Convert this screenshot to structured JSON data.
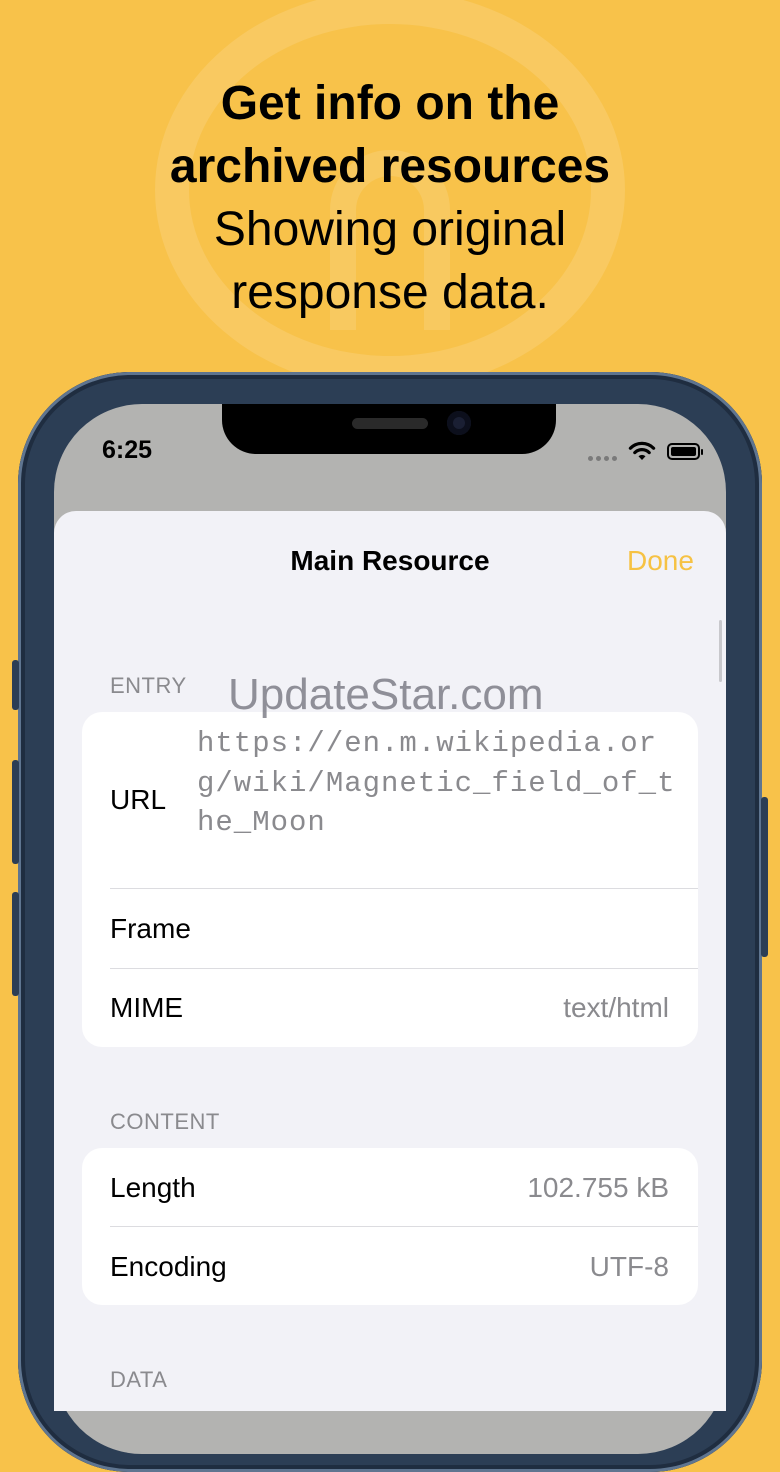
{
  "headline": {
    "bold_line1": "Get info on the",
    "bold_line2": "archived resources",
    "regular_line1": "Showing original",
    "regular_line2": "response data."
  },
  "status_bar": {
    "time": "6:25"
  },
  "nav": {
    "title": "Main Resource",
    "done_label": "Done"
  },
  "watermark": "UpdateStar.com",
  "sections": {
    "entry": {
      "header": "ENTRY",
      "url_label": "URL",
      "url_value": "https://en.m.wikipedia.org/wiki/Magnetic_field_of_the_Moon",
      "frame_label": "Frame",
      "frame_value": "",
      "mime_label": "MIME",
      "mime_value": "text/html"
    },
    "content": {
      "header": "CONTENT",
      "length_label": "Length",
      "length_value": "102.755 kB",
      "encoding_label": "Encoding",
      "encoding_value": "UTF-8"
    },
    "data": {
      "header": "DATA"
    }
  },
  "colors": {
    "background": "#F8C24A",
    "accent": "#F6C244",
    "sheet": "#F2F2F7"
  }
}
